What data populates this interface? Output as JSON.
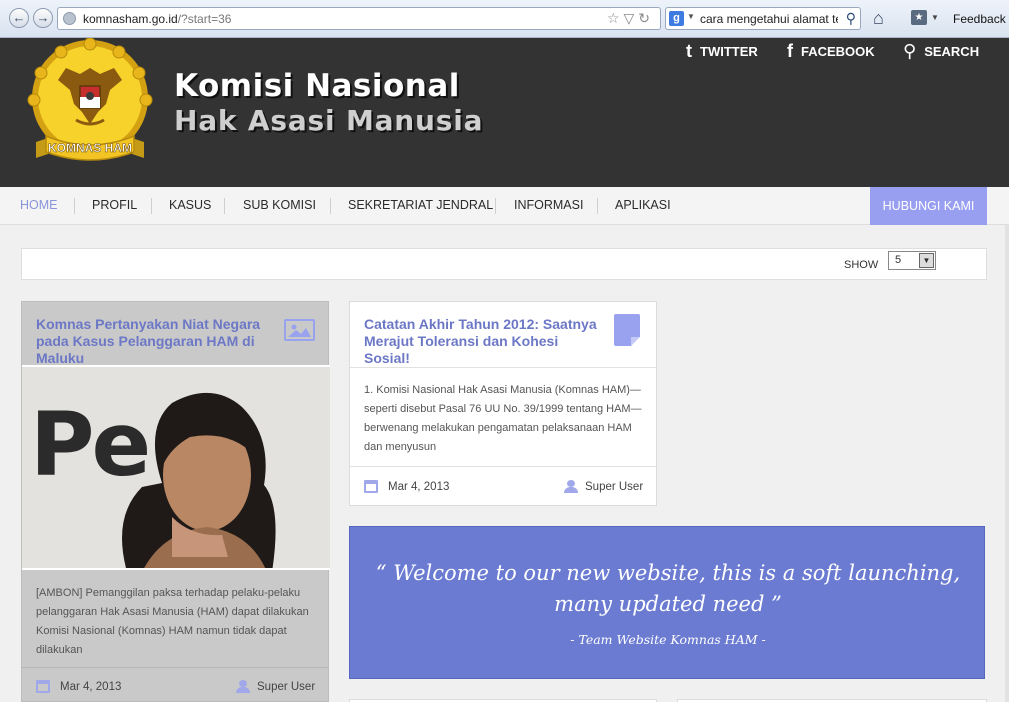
{
  "browser": {
    "url_domain": "komnasham.go.id",
    "url_path": "/?start=36",
    "search_query": "cara mengetahui alamat te",
    "search_engine_icon": "g",
    "feedback_label": "Feedback",
    "back_icon": "←",
    "forward_icon": "→",
    "url_icons": "☆▽↻",
    "home_icon": "⌂",
    "bookmark_icon": "★"
  },
  "header": {
    "title_line1": "Komisi Nasional",
    "title_line2": "Hak Asasi Manusia",
    "logo_text": "KOMNAS HAM",
    "twitter_label": "TWITTER",
    "facebook_label": "FACEBOOK",
    "search_label": "SEARCH",
    "twitter_icon": "t",
    "facebook_icon": "f",
    "search_icon": "⚲"
  },
  "nav": {
    "items": [
      "HOME",
      "PROFIL",
      "KASUS",
      "SUB KOMISI",
      "SEKRETARIAT JENDRAL",
      "INFORMASI",
      "APLIKASI"
    ],
    "active": "HOME",
    "contact_label": "HUBUNGI KAMI"
  },
  "show": {
    "label": "SHOW",
    "value": "5"
  },
  "articles": [
    {
      "title": "Komnas Pertanyakan Niat Negara pada Kasus Pelanggaran HAM di Maluku",
      "excerpt": "[AMBON] Pemanggilan paksa terhadap pelaku-pelaku pelanggaran Hak Asasi Manusia (HAM) dapat dilakukan Komisi Nasional (Komnas)  HAM namun tidak dapat dilakukan",
      "date": "Mar 4, 2013",
      "author": "Super User",
      "image_text": "Pe b"
    },
    {
      "title": "Catatan Akhir Tahun 2012: Saatnya Merajut Toleransi dan Kohesi Sosial!",
      "excerpt": "1. Komisi Nasional Hak Asasi Manusia (Komnas HAM)—seperti disebut Pasal 76 UU No. 39/1999 tentang HAM—berwenang melakukan pengamatan pelaksanaan HAM dan menyusun",
      "date": "Mar 4, 2013",
      "author": "Super User"
    }
  ],
  "quote": {
    "text": "“ Welcome to our new website, this is a soft launching, many updated need ”",
    "author": "- Team Website Komnas HAM -"
  },
  "colors": {
    "accent": "#6c78c6",
    "header_bg": "#333333",
    "quote_bg": "#6b7bd1",
    "contact_bg": "#999ff0"
  }
}
